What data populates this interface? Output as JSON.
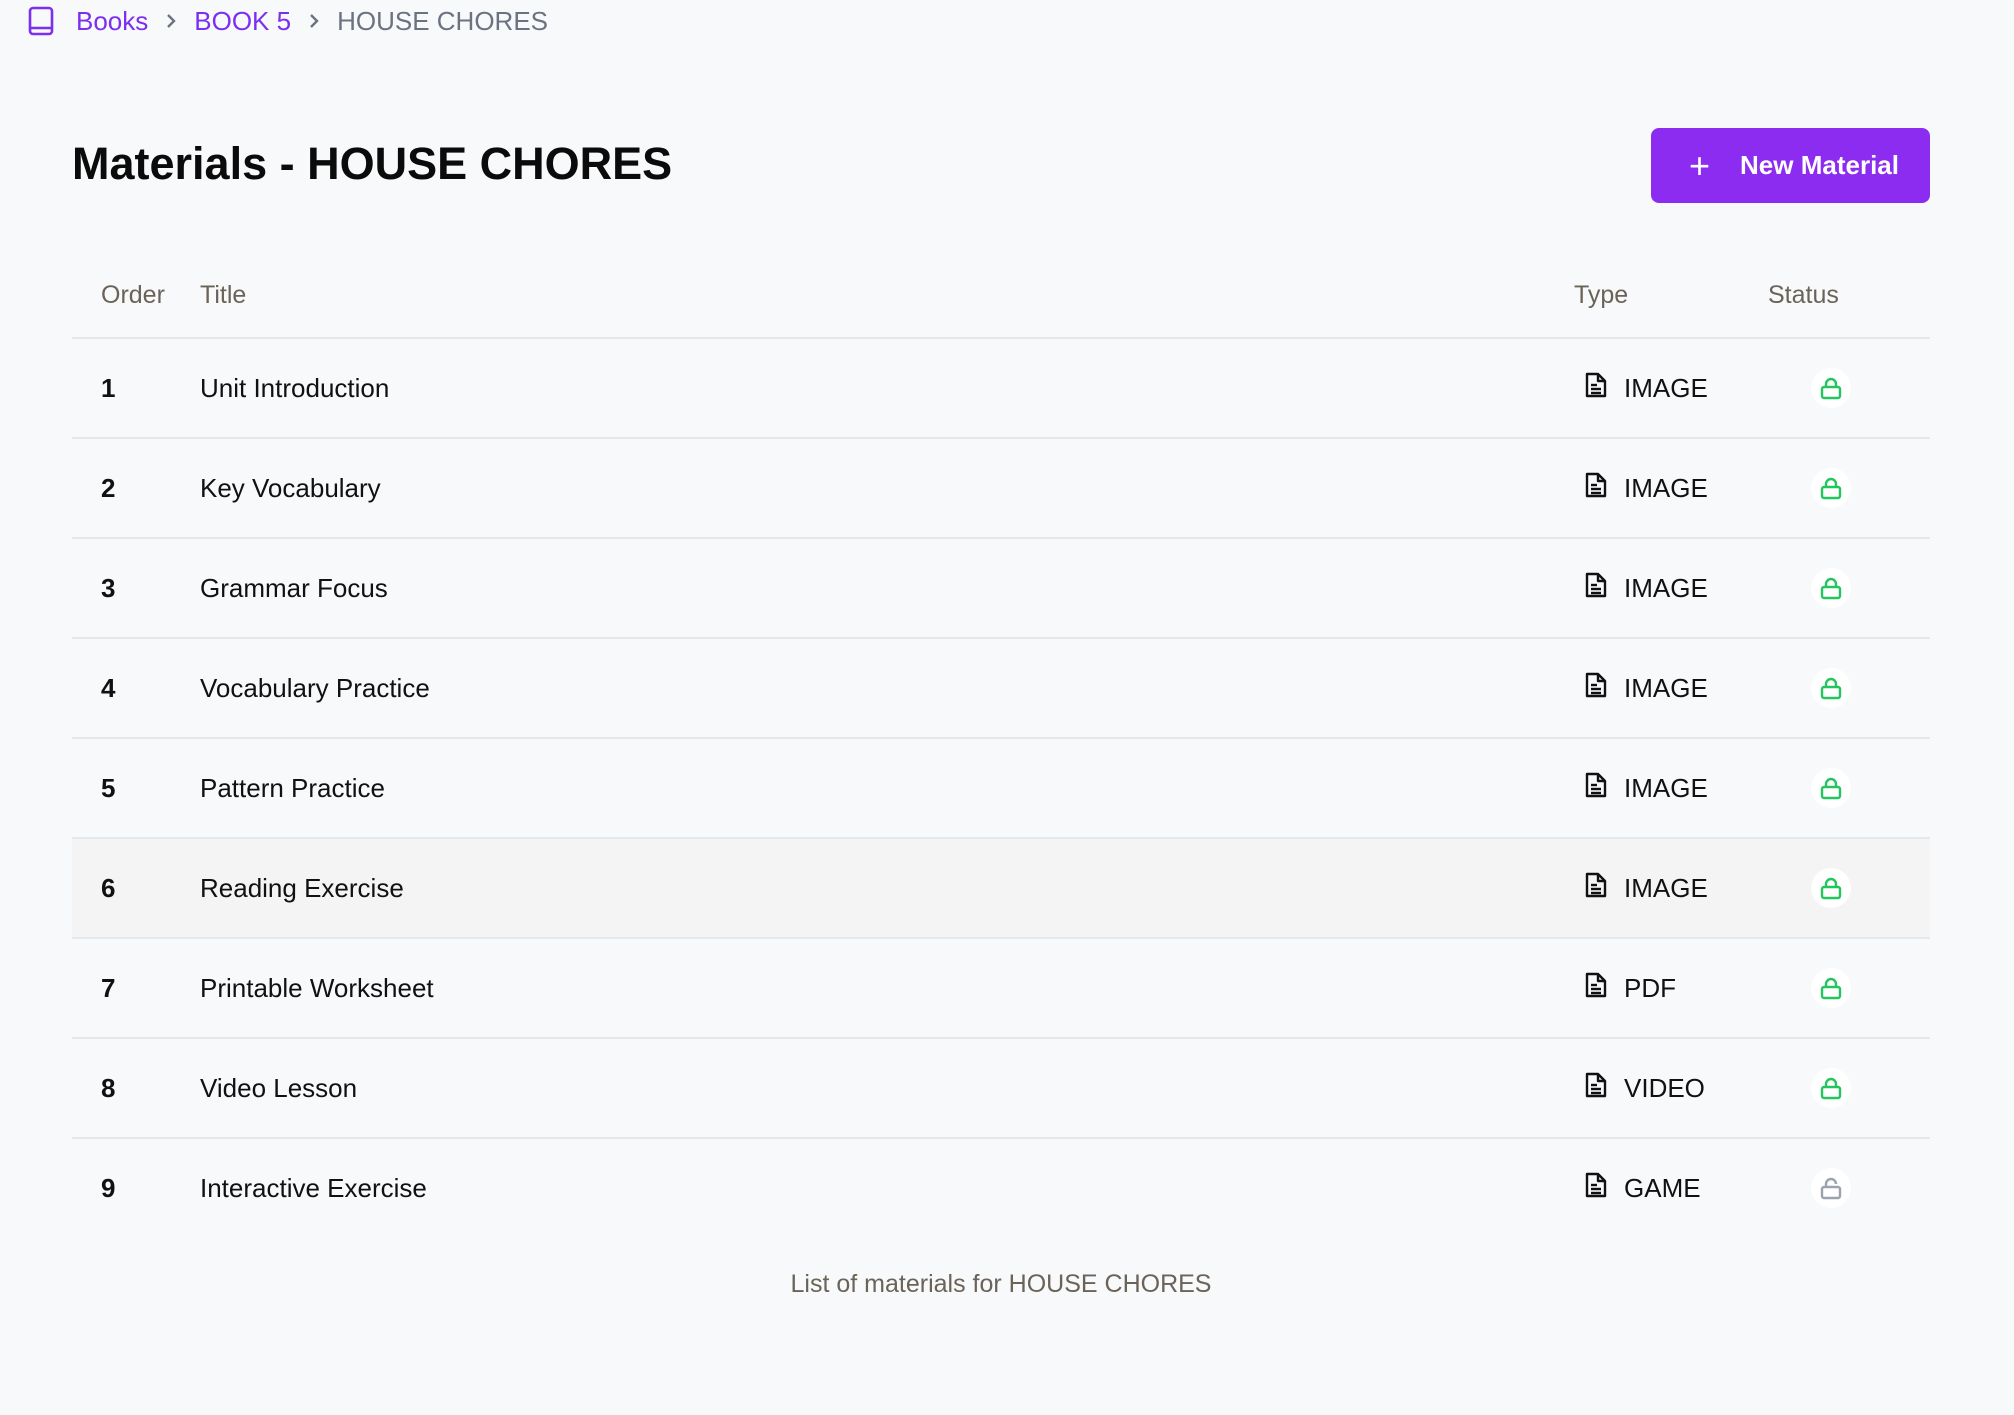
{
  "breadcrumb": {
    "items": [
      "Books",
      "BOOK 5"
    ],
    "current": "HOUSE CHORES"
  },
  "page": {
    "title": "Materials - HOUSE CHORES",
    "new_button": "New Material",
    "caption": "List of materials for HOUSE CHORES"
  },
  "table": {
    "headers": {
      "order": "Order",
      "title": "Title",
      "type": "Type",
      "status": "Status"
    },
    "rows": [
      {
        "order": "1",
        "title": "Unit Introduction",
        "type": "IMAGE",
        "status": "locked"
      },
      {
        "order": "2",
        "title": "Key Vocabulary",
        "type": "IMAGE",
        "status": "locked"
      },
      {
        "order": "3",
        "title": "Grammar Focus",
        "type": "IMAGE",
        "status": "locked"
      },
      {
        "order": "4",
        "title": "Vocabulary Practice",
        "type": "IMAGE",
        "status": "locked"
      },
      {
        "order": "5",
        "title": "Pattern Practice",
        "type": "IMAGE",
        "status": "locked"
      },
      {
        "order": "6",
        "title": "Reading Exercise",
        "type": "IMAGE",
        "status": "locked"
      },
      {
        "order": "7",
        "title": "Printable Worksheet",
        "type": "PDF",
        "status": "locked"
      },
      {
        "order": "8",
        "title": "Video Lesson",
        "type": "VIDEO",
        "status": "locked"
      },
      {
        "order": "9",
        "title": "Interactive Exercise",
        "type": "GAME",
        "status": "unlocked"
      }
    ]
  },
  "colors": {
    "accent": "#8b2cf0",
    "locked": "#22c55e",
    "unlocked": "#9ca3af"
  }
}
